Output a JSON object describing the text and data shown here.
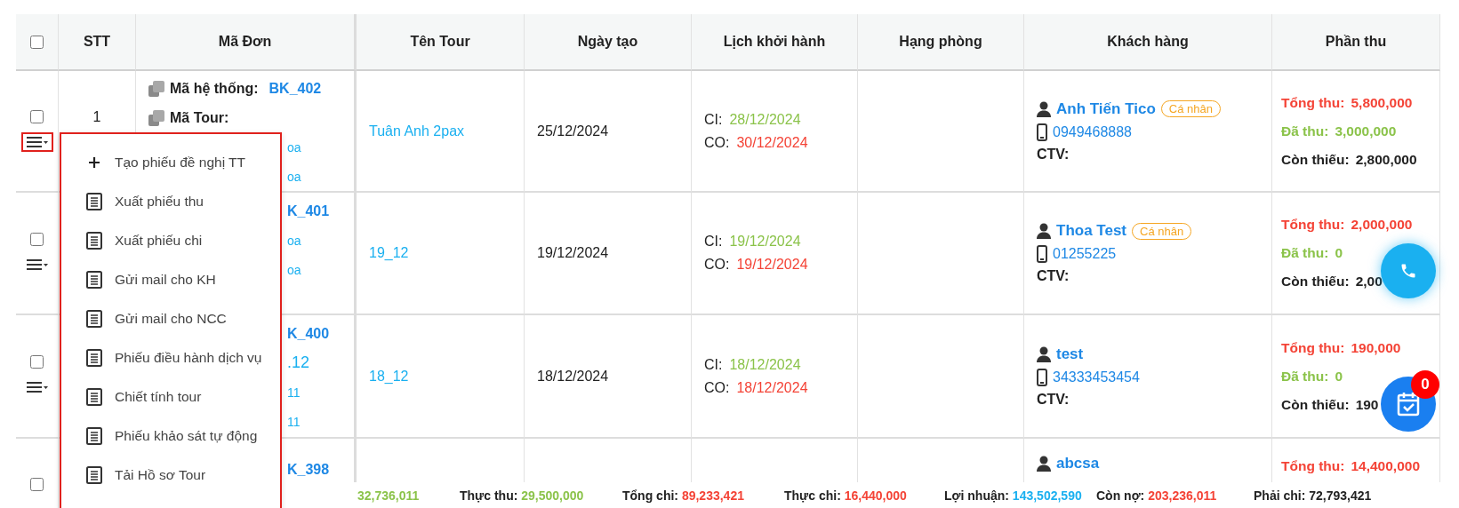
{
  "table": {
    "columns": [
      {
        "kind": "checkbox",
        "checked": false
      },
      {
        "kind": "text",
        "label": "STT"
      },
      {
        "kind": "text",
        "label": "Mã Đơn"
      },
      {
        "kind": "text",
        "label": "Tên Tour"
      },
      {
        "kind": "text",
        "label": "Ngày tạo"
      },
      {
        "kind": "text",
        "label": "Lịch khởi hành"
      },
      {
        "kind": "text",
        "label": "Hạng phòng"
      },
      {
        "kind": "text",
        "label": "Khách hàng"
      },
      {
        "kind": "text",
        "label": "Phần thu"
      }
    ],
    "rows": [
      {
        "checked": false,
        "menu": {
          "expanded": true
        },
        "stt": "1",
        "codes": [
          {
            "kind": "code",
            "label": "Mã hệ thống:",
            "value": "BK_402"
          },
          {
            "kind": "code",
            "label": "Mã Tour:"
          },
          {
            "kind": "fragment",
            "text": "oa"
          },
          {
            "kind": "fragment",
            "text": "oa"
          }
        ],
        "tour": "Tuân Anh 2pax",
        "created": "25/12/2024",
        "schedule": [
          {
            "kind": "ci",
            "label": "CI:",
            "date": "28/12/2024"
          },
          {
            "kind": "co",
            "label": "CO:",
            "date": "30/12/2024"
          }
        ],
        "customer": {
          "name": "Anh Tiến Tico",
          "badge": "Cá nhân",
          "phone": "0949468888",
          "ctv": "CTV:"
        },
        "payments": [
          {
            "kind": "total",
            "label": "Tổng thu:",
            "value": "5,800,000"
          },
          {
            "kind": "paid",
            "label": "Đã thu:",
            "value": "3,000,000"
          },
          {
            "kind": "remaining",
            "label": "Còn thiếu:",
            "value": "2,800,000"
          }
        ]
      },
      {
        "checked": false,
        "menu": {
          "expanded": false
        },
        "codes": [
          {
            "kind": "fragment-bold",
            "text": "K_401"
          },
          {
            "kind": "fragment",
            "text": "oa"
          },
          {
            "kind": "fragment",
            "text": "oa"
          }
        ],
        "tour": "19_12",
        "created": "19/12/2024",
        "schedule": [
          {
            "kind": "ci",
            "label": "CI:",
            "date": "19/12/2024"
          },
          {
            "kind": "co",
            "label": "CO:",
            "date": "19/12/2024"
          }
        ],
        "customer": {
          "name": "Thoa Test",
          "badge": "Cá nhân",
          "phone": "01255225",
          "ctv": "CTV:"
        },
        "payments": [
          {
            "kind": "total",
            "label": "Tổng thu:",
            "value": "2,000,000"
          },
          {
            "kind": "paid",
            "label": "Đã thu:",
            "value": "0"
          },
          {
            "kind": "remaining",
            "label": "Còn thiếu:",
            "value": "2,00"
          }
        ]
      },
      {
        "checked": false,
        "menu": {
          "expanded": false
        },
        "codes": [
          {
            "kind": "fragment-bold",
            "text": "K_400"
          },
          {
            "kind": "fragment-large",
            "text": ".12"
          },
          {
            "kind": "fragment",
            "text": "11"
          },
          {
            "kind": "fragment",
            "text": "11"
          }
        ],
        "tour": "18_12",
        "created": "18/12/2024",
        "schedule": [
          {
            "kind": "ci",
            "label": "CI:",
            "date": "18/12/2024"
          },
          {
            "kind": "co",
            "label": "CO:",
            "date": "18/12/2024"
          }
        ],
        "customer": {
          "name": "test",
          "phone": "34333453454",
          "ctv": "CTV:"
        },
        "payments": [
          {
            "kind": "total",
            "label": "Tổng thu:",
            "value": "190,000"
          },
          {
            "kind": "paid",
            "label": "Đã thu:",
            "value": "0"
          },
          {
            "kind": "remaining",
            "label": "Còn thiếu:",
            "value": "190"
          }
        ]
      },
      {
        "checked": false,
        "codes": [
          {
            "kind": "fragment-bold",
            "text": "K_398"
          }
        ],
        "customer": {
          "name": "abcsa"
        },
        "payments": [
          {
            "kind": "total",
            "label": "Tổng thu:",
            "value": "14,400,000"
          }
        ]
      }
    ]
  },
  "action_menu": {
    "items": [
      {
        "kind": "plus",
        "label": "Tạo phiếu đề nghị TT"
      },
      {
        "kind": "document",
        "label": "Xuất phiếu thu"
      },
      {
        "kind": "document",
        "label": "Xuất phiếu chi"
      },
      {
        "kind": "document",
        "label": "Gửi mail cho KH"
      },
      {
        "kind": "document",
        "label": "Gửi mail cho NCC"
      },
      {
        "kind": "document",
        "label": "Phiếu điều hành dịch vụ"
      },
      {
        "kind": "document",
        "label": "Chiết tính tour"
      },
      {
        "kind": "document",
        "label": "Phiếu khảo sát tự động"
      },
      {
        "kind": "document",
        "label": "Tải Hồ sơ Tour"
      }
    ]
  },
  "summary_bar": [
    {
      "value": "32,736,011",
      "color": "#8bc34a"
    },
    {
      "label": "Thực thu:",
      "value": "29,500,000",
      "color": "#8bc34a"
    },
    {
      "label": "Tổng chi:",
      "value": "89,233,421",
      "color": "#f44336"
    },
    {
      "label": "Thực chi:",
      "value": "16,440,000",
      "color": "#f44336"
    },
    {
      "label": "Lợi nhuận:",
      "value": "143,502,590",
      "color": "#1ab0f0"
    },
    {
      "label": "Còn nợ:",
      "value": "203,236,011",
      "color": "#f44336"
    },
    {
      "label": "Phải chi:",
      "value": "72,793,421",
      "color": "#222222"
    }
  ],
  "floating": {
    "calendar_badge": "0"
  }
}
